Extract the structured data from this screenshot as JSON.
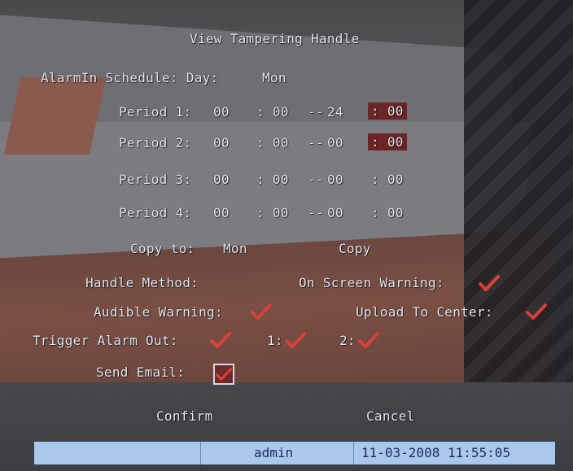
{
  "title": "View Tampering Handle",
  "schedule": {
    "label": "AlarmIn Schedule: Day:",
    "day": "Mon",
    "periods": [
      {
        "label": "Period 1:",
        "start_h": "00",
        "start_m": ": 00",
        "sep": "--",
        "end_h": "24",
        "end_m": ": 00"
      },
      {
        "label": "Period 2:",
        "start_h": "00",
        "start_m": ": 00",
        "sep": "--",
        "end_h": "00",
        "end_m": ": 00"
      },
      {
        "label": "Period 3:",
        "start_h": "00",
        "start_m": ": 00",
        "sep": "--",
        "end_h": "00",
        "end_m": ": 00"
      },
      {
        "label": "Period 4:",
        "start_h": "00",
        "start_m": ": 00",
        "sep": "--",
        "end_h": "00",
        "end_m": ": 00"
      }
    ],
    "copy_to_label": "Copy to:",
    "copy_to_value": "Mon",
    "copy_button": "Copy"
  },
  "handle": {
    "method_label": "Handle Method:",
    "on_screen_label": "On Screen Warning:",
    "audible_label": "Audible Warning:",
    "upload_label": "Upload To Center:",
    "trigger_label": "Trigger Alarm Out:",
    "out1_label": "1:",
    "out2_label": "2:",
    "email_label": "Send Email:"
  },
  "buttons": {
    "confirm": "Confirm",
    "cancel": "Cancel"
  },
  "statusbar": {
    "user": "admin",
    "datetime": "11-03-2008 11:55:05"
  },
  "colors": {
    "check": "#d9413a",
    "highlight": "#6b2526",
    "statusbar": "#a9c8ec"
  }
}
